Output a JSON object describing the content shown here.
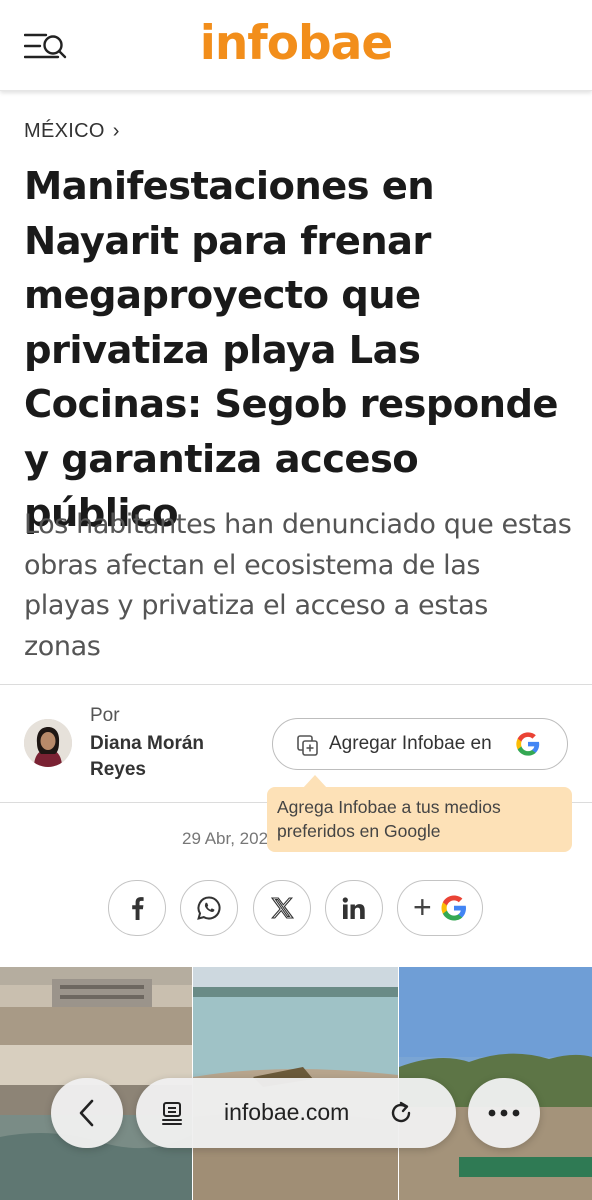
{
  "header": {
    "brand": "infobae",
    "menu_icon": "menu-search-icon",
    "brand_color": "#f28e1b"
  },
  "article": {
    "section": "MÉXICO",
    "headline": "Manifestaciones en Nayarit para frenar megaproyecto que privatiza playa Las Cocinas: Segob responde y garantiza acceso público",
    "subheadline": "Los habitantes han denunciado que estas obras afectan el ecosistema de las playas y privatiza el acceso a estas zonas",
    "byline_label": "Por",
    "author": "Diana Morán Reyes",
    "date": "29 Abr, 202"
  },
  "google_prompt": {
    "button_label": "Agregar Infobae en",
    "tooltip": "Agrega Infobae a tus medios preferidos en Google"
  },
  "share": {
    "buttons": [
      {
        "icon": "facebook-icon"
      },
      {
        "icon": "whatsapp-icon"
      },
      {
        "icon": "x-icon"
      },
      {
        "icon": "linkedin-icon"
      },
      {
        "label": "+",
        "icon": "google-icon"
      }
    ]
  },
  "browser": {
    "url": "infobae.com",
    "back_icon": "back-icon",
    "menu_icon": "more-icon"
  }
}
